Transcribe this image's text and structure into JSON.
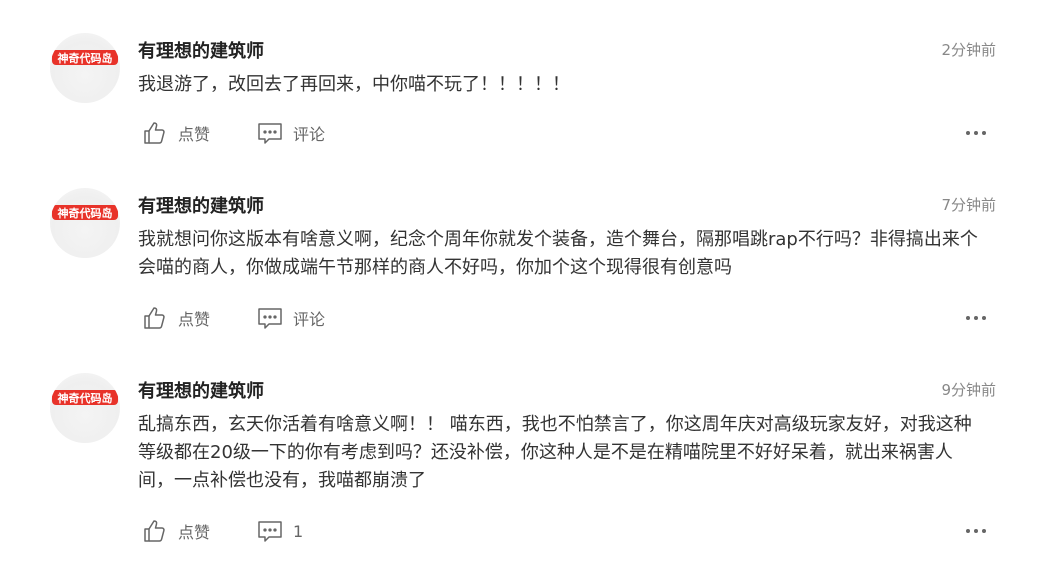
{
  "comments": [
    {
      "author": "有理想的建筑师",
      "time": "2分钟前",
      "content": "我退游了，改回去了再回来，中你喵不玩了！！！！！",
      "like_label": "点赞",
      "comment_label": "评论"
    },
    {
      "author": "有理想的建筑师",
      "time": "7分钟前",
      "content": "我就想问你这版本有啥意义啊，纪念个周年你就发个装备，造个舞台，隔那唱跳rap不行吗？非得搞出来个会喵的商人，你做成端午节那样的商人不好吗，你加个这个现得很有创意吗",
      "like_label": "点赞",
      "comment_label": "评论"
    },
    {
      "author": "有理想的建筑师",
      "time": "9分钟前",
      "content": "乱搞东西，玄天你活着有啥意义啊！！ 喵东西，我也不怕禁言了，你这周年庆对高级玩家友好，对我这种等级都在20级一下的你有考虑到吗？还没补偿，你这种人是不是在精喵院里不好好呆着，就出来祸害人间，一点补偿也没有，我喵都崩溃了",
      "like_label": "点赞",
      "comment_label": "1"
    }
  ],
  "avatar_logo_text": "神奇代码岛",
  "colors": {
    "logo_red": "#e8332a",
    "icon_gray": "#666666"
  },
  "icons": {
    "like": "thumbs-up-icon",
    "comment": "comment-bubble-icon",
    "more": "more-dots-icon"
  }
}
